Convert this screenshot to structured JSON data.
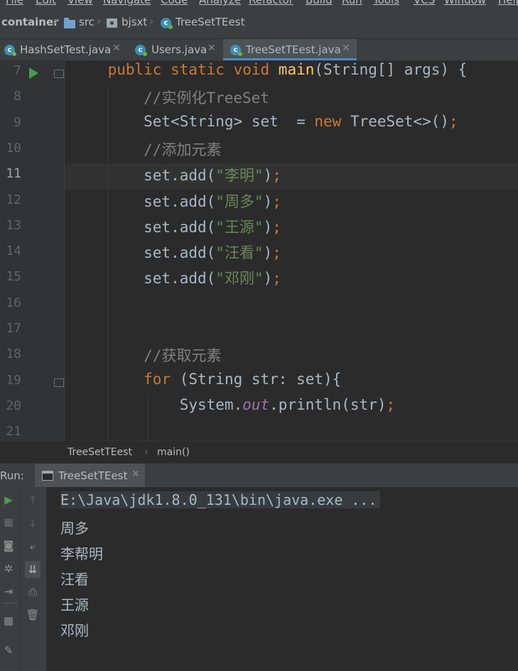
{
  "menu": [
    "File",
    "Edit",
    "View",
    "Navigate",
    "Code",
    "Analyze",
    "Refactor",
    "Build",
    "Run",
    "Tools",
    "VCS",
    "Window",
    "Help"
  ],
  "breadcrumb": {
    "root": "container",
    "folder": "src",
    "package": "bjsxt",
    "file": "TreeSetTEest"
  },
  "tabs": [
    {
      "label": "HashSetTest.java",
      "active": false
    },
    {
      "label": "Users.java",
      "active": false
    },
    {
      "label": "TreeSetTEest.java",
      "active": true
    }
  ],
  "editor": {
    "lines": [
      {
        "num": "7",
        "tokens": [
          [
            "    ",
            ""
          ],
          [
            "public static void ",
            "kw"
          ],
          [
            "main",
            "fn"
          ],
          [
            "(String[] args) {",
            ""
          ]
        ]
      },
      {
        "num": "8",
        "tokens": [
          [
            "        ",
            ""
          ],
          [
            "//实例化TreeSet",
            "cm"
          ]
        ]
      },
      {
        "num": "9",
        "tokens": [
          [
            "        Set<String> set  = ",
            ""
          ],
          [
            "new ",
            "kw"
          ],
          [
            "TreeSet<>()",
            ""
          ],
          [
            ";",
            "kw"
          ]
        ]
      },
      {
        "num": "10",
        "tokens": [
          [
            "        ",
            ""
          ],
          [
            "//添加元素",
            "cm"
          ]
        ]
      },
      {
        "num": "11",
        "tokens": [
          [
            "        set.add(",
            ""
          ],
          [
            "\"李明\"",
            "str"
          ],
          [
            ")",
            ""
          ],
          [
            ";",
            "kw"
          ]
        ]
      },
      {
        "num": "12",
        "tokens": [
          [
            "        set.add(",
            ""
          ],
          [
            "\"周多\"",
            "str"
          ],
          [
            ")",
            ""
          ],
          [
            ";",
            "kw"
          ]
        ]
      },
      {
        "num": "13",
        "tokens": [
          [
            "        set.add(",
            ""
          ],
          [
            "\"王源\"",
            "str"
          ],
          [
            ")",
            ""
          ],
          [
            ";",
            "kw"
          ]
        ]
      },
      {
        "num": "14",
        "tokens": [
          [
            "        set.add(",
            ""
          ],
          [
            "\"汪看\"",
            "str"
          ],
          [
            ")",
            ""
          ],
          [
            ";",
            "kw"
          ]
        ]
      },
      {
        "num": "15",
        "tokens": [
          [
            "        set.add(",
            ""
          ],
          [
            "\"邓刚\"",
            "str"
          ],
          [
            ")",
            ""
          ],
          [
            ";",
            "kw"
          ]
        ]
      },
      {
        "num": "16",
        "tokens": []
      },
      {
        "num": "17",
        "tokens": []
      },
      {
        "num": "18",
        "tokens": [
          [
            "        ",
            ""
          ],
          [
            "//获取元素",
            "cm"
          ]
        ]
      },
      {
        "num": "19",
        "tokens": [
          [
            "        ",
            ""
          ],
          [
            "for ",
            "kw"
          ],
          [
            "(String str: set){",
            ""
          ]
        ]
      },
      {
        "num": "20",
        "tokens": [
          [
            "            System.",
            ""
          ],
          [
            "out",
            "fld"
          ],
          [
            ".println(str)",
            ""
          ],
          [
            ";",
            "kw"
          ]
        ]
      },
      {
        "num": "21",
        "tokens": []
      }
    ],
    "current_line": "11"
  },
  "code_breadcrumb": {
    "class": "TreeSetTEest",
    "sep": "›",
    "method": "main()"
  },
  "run": {
    "label": "Run:",
    "tab": "TreeSetTEest",
    "output": [
      "E:\\Java\\jdk1.8.0_131\\bin\\java.exe ...",
      "周多",
      "李帮明",
      "汪看",
      "王源",
      "邓刚"
    ]
  },
  "icons": {
    "run": "play-icon",
    "stop": "stop-icon",
    "up": "arrow-up-icon",
    "down": "arrow-down-icon",
    "camera": "camera-icon",
    "wrap": "soft-wrap-icon",
    "settings": "gear-icon",
    "scroll": "scroll-to-end-icon",
    "print": "print-icon",
    "login": "exit-icon",
    "delete": "trash-icon",
    "layout": "layout-icon",
    "pin": "pin-icon"
  },
  "colors": {
    "keyword": "#cc7832",
    "function": "#ffc66d",
    "comment": "#808080",
    "string": "#6a8759",
    "field": "#9876aa",
    "text": "#a9b7c6",
    "accent": "#4a88c7"
  }
}
